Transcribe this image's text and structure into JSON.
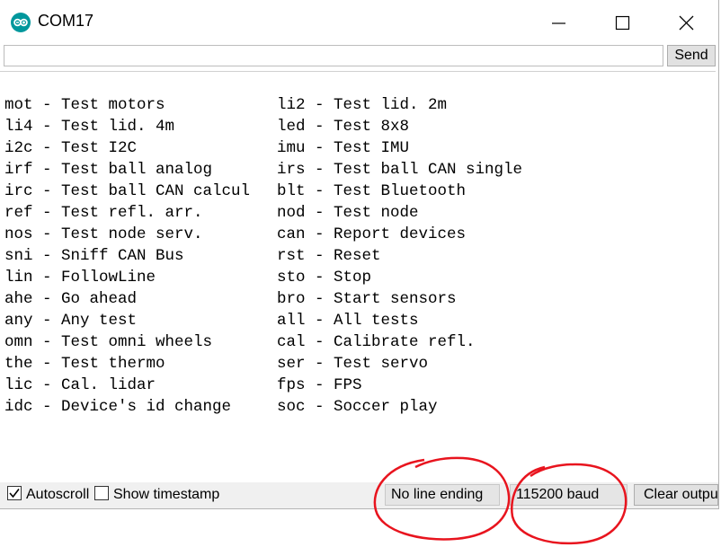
{
  "window": {
    "title": "COM17"
  },
  "icons": {
    "app": "arduino-icon",
    "minimize": "minimize-icon",
    "maximize": "maximize-icon",
    "close": "close-icon",
    "checkmark": "checkmark-icon"
  },
  "input": {
    "value": "",
    "send_label": "Send"
  },
  "output": {
    "left_lines": [
      "mot - Test motors",
      "li4 - Test lid. 4m",
      "i2c - Test I2C",
      "irf - Test ball analog",
      "irc - Test ball CAN calcul",
      "ref - Test refl. arr.",
      "nos - Test node serv.",
      "sni - Sniff CAN Bus",
      "lin - FollowLine",
      "ahe - Go ahead",
      "any - Any test",
      "omn - Test omni wheels",
      "the - Test thermo",
      "lic - Cal. lidar",
      "idc - Device's id change"
    ],
    "right_lines": [
      "li2 - Test lid. 2m",
      "led - Test 8x8",
      "imu - Test IMU",
      "irs - Test ball CAN single",
      "blt - Test Bluetooth",
      "nod - Test node",
      "can - Report devices",
      "rst - Reset",
      "sto - Stop",
      "bro - Start sensors",
      "all - All tests",
      "cal - Calibrate refl.",
      "ser - Test servo",
      "fps - FPS",
      "soc - Soccer play"
    ]
  },
  "statusbar": {
    "autoscroll": {
      "label": "Autoscroll",
      "checked": true
    },
    "timestamp": {
      "label": "Show timestamp",
      "checked": false
    },
    "line_ending": "No line ending",
    "baud": "115200 baud",
    "clear_label": "Clear output"
  },
  "colors": {
    "annotation": "#e8141e",
    "arduino_teal": "#00979c"
  }
}
